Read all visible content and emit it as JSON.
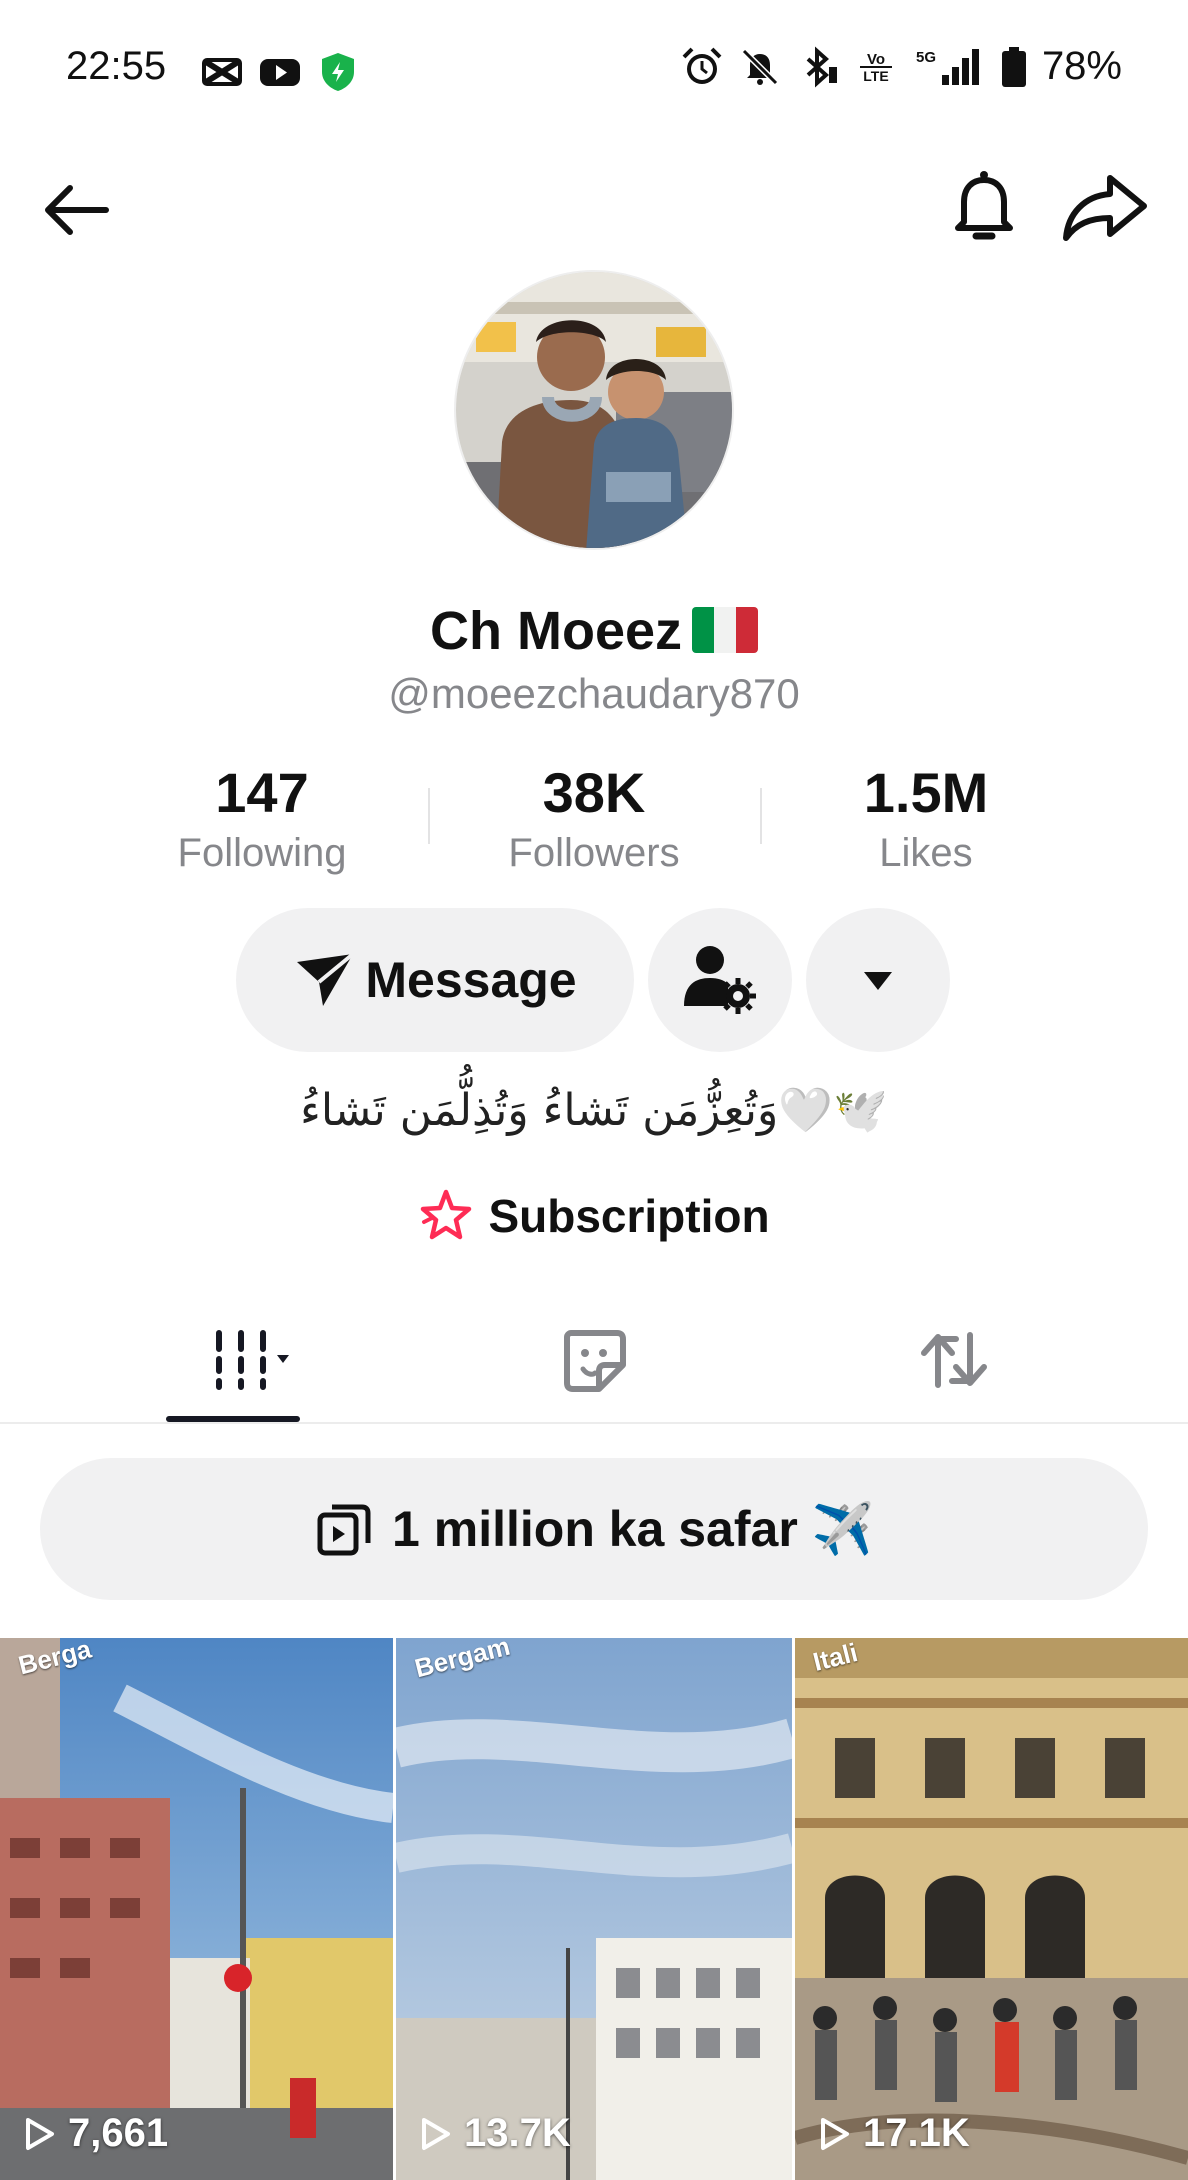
{
  "status_bar": {
    "time": "22:55",
    "battery": "78%",
    "left_icons": [
      "capcut-icon",
      "youtube-icon",
      "vpn-shield-icon"
    ],
    "right_icons": [
      "alarm-icon",
      "mute-icon",
      "bluetooth-icon",
      "volte-icon",
      "signal-5g-icon",
      "battery-icon"
    ]
  },
  "header": {
    "back_icon": "arrow-left-icon",
    "bell_icon": "bell-icon",
    "share_icon": "share-icon"
  },
  "profile": {
    "name": "Ch Moeez",
    "flag": "italy-flag",
    "handle": "@moeezchaudary870"
  },
  "stats": [
    {
      "value": "147",
      "label": "Following"
    },
    {
      "value": "38K",
      "label": "Followers"
    },
    {
      "value": "1.5M",
      "label": "Likes"
    }
  ],
  "actions": {
    "message_label": "Message",
    "follow_settings_icon": "user-gear-icon",
    "more_icon": "caret-down-icon"
  },
  "bio": "وَتُعِزُّمَن تَشاءُ وَتُذِلُّمَن تَشاءُ🤍🕊️",
  "subscription": {
    "label": "Subscription",
    "icon": "star-icon"
  },
  "tabs": [
    {
      "name": "videos",
      "icon": "grid-icon",
      "active": true
    },
    {
      "name": "favorites",
      "icon": "sticker-icon",
      "active": false
    },
    {
      "name": "reposts",
      "icon": "repost-icon",
      "active": false
    }
  ],
  "playlist": {
    "label": "1 million ka safar ✈️",
    "icon": "playlist-icon"
  },
  "videos": [
    {
      "views": "7,661",
      "tag": "Berga"
    },
    {
      "views": "13.7K",
      "tag": "Bergam"
    },
    {
      "views": "17.1K",
      "tag": "Itali"
    }
  ],
  "colors": {
    "accent_pink": "#fe2c55",
    "text_primary": "#161823",
    "text_secondary": "#86878b",
    "button_bg": "#f1f1f2"
  }
}
